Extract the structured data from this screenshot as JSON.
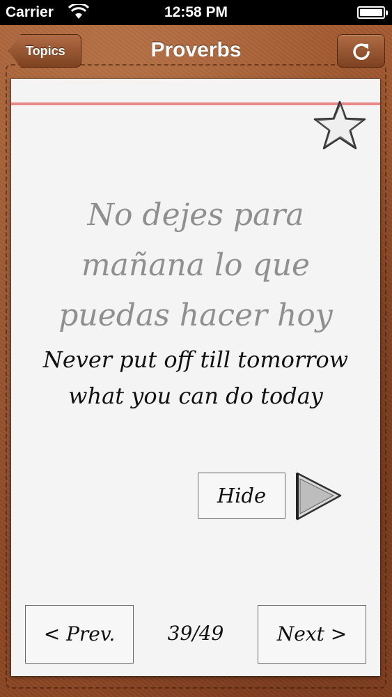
{
  "status_bar": {
    "carrier": "Carrier",
    "time": "12:58 PM"
  },
  "nav": {
    "back_label": "Topics",
    "title": "Proverbs",
    "refresh_icon": "refresh-icon"
  },
  "card": {
    "favorite_icon": "star-icon",
    "spanish_text": "No dejes para mañana lo que puedas hacer hoy",
    "english_text": "Never put off till tomorrow what you can do today",
    "hide_label": "Hide",
    "play_icon": "play-icon",
    "prev_label": "< Prev.",
    "next_label": "Next >",
    "page_counter": "39/49"
  },
  "colors": {
    "leather": "#8e4b27",
    "paper": "#f4f4f4",
    "red_rule": "#e88888",
    "spanish_text": "#8f8f8f"
  }
}
